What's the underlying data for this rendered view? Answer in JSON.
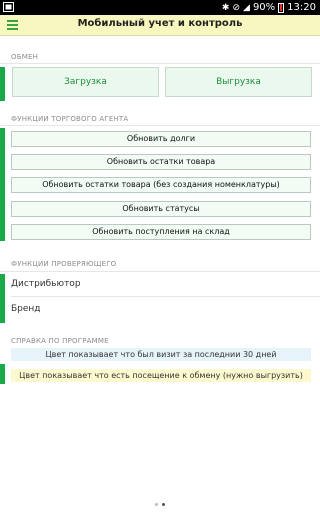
{
  "status_bar": {
    "battery_percent": "90%",
    "time": "13:20"
  },
  "app_bar": {
    "title": "Мобильный учет и контроль"
  },
  "sections": {
    "exchange": {
      "label": "ОБМЕН",
      "download": "Загрузка",
      "upload": "Выгрузка"
    },
    "agent": {
      "label": "ФУНКЦИИ ТОРГОВОГО АГЕНТА",
      "buttons": [
        "Обновить долги",
        "Обновить остатки товара",
        "Обновить остатки товара (без создания номенклатуры)",
        "Обновить статусы",
        "Обновить поступления на склад"
      ]
    },
    "inspector": {
      "label": "ФУНКЦИИ ПРОВЕРЯЮЩЕГО",
      "fields": [
        "Дистрибьютор",
        "Бренд"
      ]
    },
    "help": {
      "label": "СПРАВКА ПО ПРОГРАММЕ",
      "lines": [
        "Цвет показывает что был визит за последнии 30 дней",
        "Цвет показывает что есть посещение к обмену (нужно выгрузить)"
      ],
      "line_colors": [
        "#e6f3fb",
        "#fcf9cf"
      ]
    }
  },
  "pager": {
    "pages": 2,
    "current": 2
  },
  "colors": {
    "accent": "#19a84a",
    "appbar": "#f8f7bf"
  }
}
